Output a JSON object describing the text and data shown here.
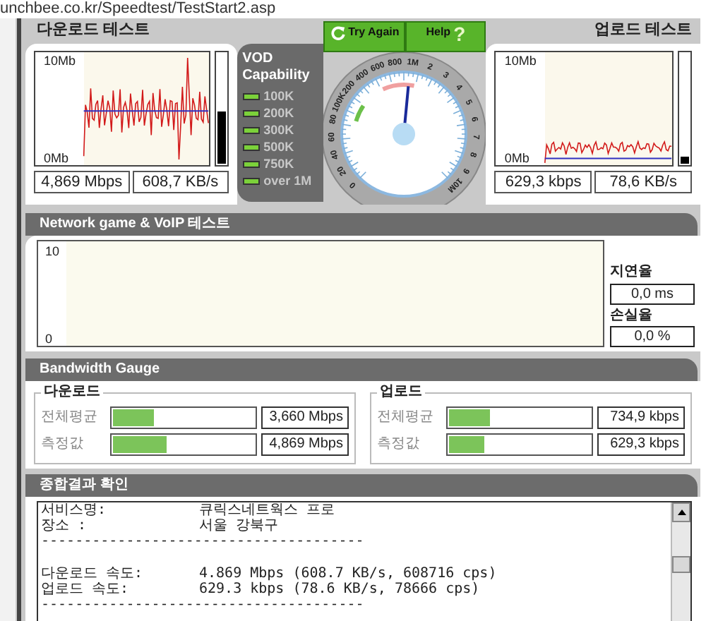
{
  "address_bar": {
    "url": "unchbee.co.kr/Speedtest/TestStart2.asp"
  },
  "download_test": {
    "title": "다운로드 테스트",
    "chart_top_label": "10Mb",
    "chart_bottom_label": "0Mb",
    "meter": {
      "level": 0.48
    },
    "readouts": [
      "4,869 Mbps",
      "608,7 KB/s"
    ]
  },
  "vod": {
    "title": "VOD Capability",
    "items": [
      {
        "label": "100K",
        "on": true
      },
      {
        "label": "200K",
        "on": true
      },
      {
        "label": "300K",
        "on": true
      },
      {
        "label": "500K",
        "on": true
      },
      {
        "label": "750K",
        "on": true
      },
      {
        "label": "over 1M",
        "on": true
      }
    ]
  },
  "buttons": [
    {
      "label": "Try Again",
      "kind": "refresh"
    },
    {
      "label": "Help",
      "kind": "help",
      "glyph": "?"
    }
  ],
  "dial": {
    "labels": [
      "0",
      "20",
      "40",
      "60",
      "80",
      "100K",
      "200",
      "400",
      "600",
      "800",
      "1M",
      "2",
      "3",
      "4",
      "5",
      "6",
      "7",
      "8",
      "9",
      "10M"
    ],
    "level": 0.52
  },
  "upload_test": {
    "title": "업로드 테스트",
    "chart_top_label": "10Mb",
    "chart_bottom_label": "0Mb",
    "meter": {
      "level": 0.06
    },
    "readouts": [
      "629,3 kbps",
      "78,6 KB/s"
    ]
  },
  "network_test": {
    "title": "Network game & VoIP 테스트",
    "chart_top_label": "10",
    "chart_bottom_label": "0",
    "latency_label": "지연율",
    "latency": "0,0 ms",
    "loss_label": "손실율",
    "loss": "0,0 %"
  },
  "bandwidth_gauge": {
    "title": "Bandwidth Gauge",
    "groups": [
      {
        "title": "다운로드",
        "rows": [
          {
            "label": "전체평균",
            "level": 0.29,
            "value": "3,660 Mbps"
          },
          {
            "label": "측정값",
            "level": 0.38,
            "value": "4,869 Mbps"
          }
        ]
      },
      {
        "title": "업로드",
        "rows": [
          {
            "label": "전체평균",
            "level": 0.29,
            "value": "734,9 kbps"
          },
          {
            "label": "측정값",
            "level": 0.25,
            "value": "629,3 kbps"
          }
        ]
      }
    ]
  },
  "summary": {
    "title": "종합결과 확인",
    "lines": [
      {
        "kind": "pair",
        "label": "서비스명:",
        "value": "큐릭스네트웍스 프로"
      },
      {
        "kind": "pair",
        "label": "장소 :",
        "value": "서울 강북구"
      },
      {
        "kind": "rule",
        "text": "--------------------------------------"
      },
      {
        "kind": "blank"
      },
      {
        "kind": "pair",
        "label": "다운로드 속도:",
        "value": "4.869 Mbps (608.7 KB/s, 608716 cps)"
      },
      {
        "kind": "pair",
        "label": "업로드 속도:",
        "value": "629.3 kbps (78.6 KB/s, 78666 cps)"
      },
      {
        "kind": "rule",
        "text": "--------------------------------------"
      }
    ]
  }
}
